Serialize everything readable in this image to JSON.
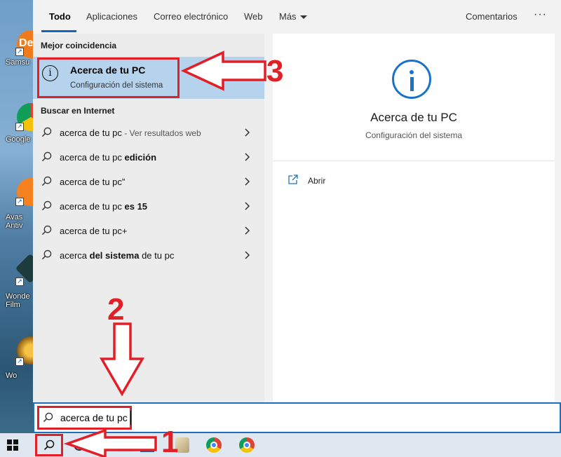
{
  "desktop": {
    "icons": [
      {
        "label": "Samsu",
        "badge": "De"
      },
      {
        "label": "Google",
        "badge": ""
      },
      {
        "label": "Avas\nAntiv",
        "badge": ""
      },
      {
        "label": "Wonde\nFilm",
        "badge": ""
      },
      {
        "label": "Wo",
        "badge": ""
      }
    ]
  },
  "tabs": {
    "items": [
      "Todo",
      "Aplicaciones",
      "Correo electrónico",
      "Web",
      "Más"
    ],
    "feedback": "Comentarios",
    "more": "···"
  },
  "results": {
    "best_header": "Mejor coincidencia",
    "best": {
      "title": "Acerca de tu PC",
      "subtitle": "Configuración del sistema"
    },
    "web_header": "Buscar en Internet",
    "web": [
      {
        "pre": "acerca de tu pc",
        "bold": "",
        "post": "",
        "hint": " - Ver resultados web"
      },
      {
        "pre": "acerca de tu pc ",
        "bold": "edición",
        "post": "",
        "hint": ""
      },
      {
        "pre": "acerca de tu pc”",
        "bold": "",
        "post": "",
        "hint": ""
      },
      {
        "pre": "acerca de tu pc ",
        "bold": "es 15",
        "post": "",
        "hint": ""
      },
      {
        "pre": "acerca de tu pc+",
        "bold": "",
        "post": "",
        "hint": ""
      },
      {
        "pre": "acerca ",
        "bold": "del sistema",
        "post": " de tu pc",
        "hint": ""
      }
    ]
  },
  "details": {
    "title": "Acerca de tu PC",
    "subtitle": "Configuración del sistema",
    "open_label": "Abrir"
  },
  "search": {
    "value": "acerca de tu pc"
  },
  "annotations": [
    "1",
    "2",
    "3"
  ],
  "colors": {
    "accent": "#1565c0",
    "highlight": "#b6d3ee",
    "annotation": "#e21f26"
  }
}
